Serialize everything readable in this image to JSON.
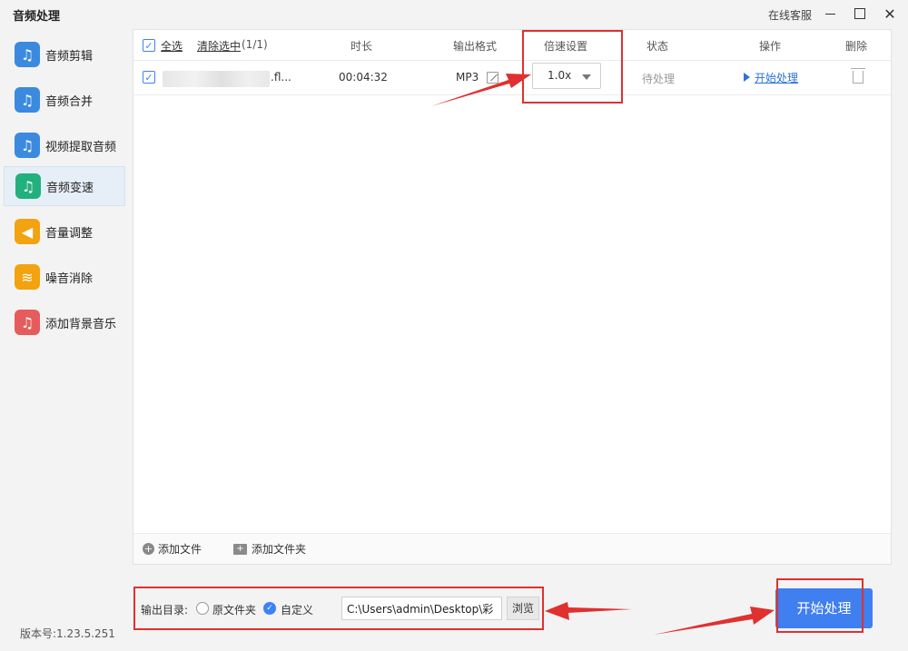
{
  "app": {
    "title": "音频处理",
    "service_label": "在线客服",
    "version": "版本号:1.23.5.251"
  },
  "sidebar": {
    "items": [
      {
        "label": "音频剪辑",
        "icon": "audio-cut-icon",
        "color": "#3b8ae0",
        "glyph": "♫"
      },
      {
        "label": "音频合并",
        "icon": "audio-merge-icon",
        "color": "#3b8ae0",
        "glyph": "♫"
      },
      {
        "label": "视频提取音频",
        "icon": "video-extract-audio-icon",
        "color": "#3b8ae0",
        "glyph": "♫"
      },
      {
        "label": "音频变速",
        "icon": "audio-speed-icon",
        "color": "#22b07d",
        "glyph": "♫"
      },
      {
        "label": "音量调整",
        "icon": "volume-icon",
        "color": "#f2a30f",
        "glyph": "◀"
      },
      {
        "label": "噪音消除",
        "icon": "noise-removal-icon",
        "color": "#f2a30f",
        "glyph": "≋"
      },
      {
        "label": "添加背景音乐",
        "icon": "background-music-icon",
        "color": "#e65c5c",
        "glyph": "♫"
      }
    ],
    "active_index": 3
  },
  "table": {
    "select_all": "全选",
    "clear_selected": "清除选中",
    "selected_count": "(1/1)",
    "columns": {
      "duration": "时长",
      "format": "输出格式",
      "speed": "倍速设置",
      "status": "状态",
      "action": "操作",
      "delete": "删除"
    },
    "rows": [
      {
        "filename_suffix": ".fl...",
        "duration": "00:04:32",
        "format": "MP3",
        "speed": "1.0x",
        "status": "待处理",
        "action": "开始处理"
      }
    ]
  },
  "footer": {
    "add_file": "添加文件",
    "add_folder": "添加文件夹"
  },
  "output": {
    "label": "输出目录:",
    "option_original": "原文件夹",
    "option_custom": "自定义",
    "path": "C:\\Users\\admin\\Desktop\\彩",
    "browse": "浏览"
  },
  "start_button": "开始处理",
  "colors": {
    "accent": "#3f7ff0",
    "annotation": "#e03030",
    "link": "#2b73d8"
  }
}
